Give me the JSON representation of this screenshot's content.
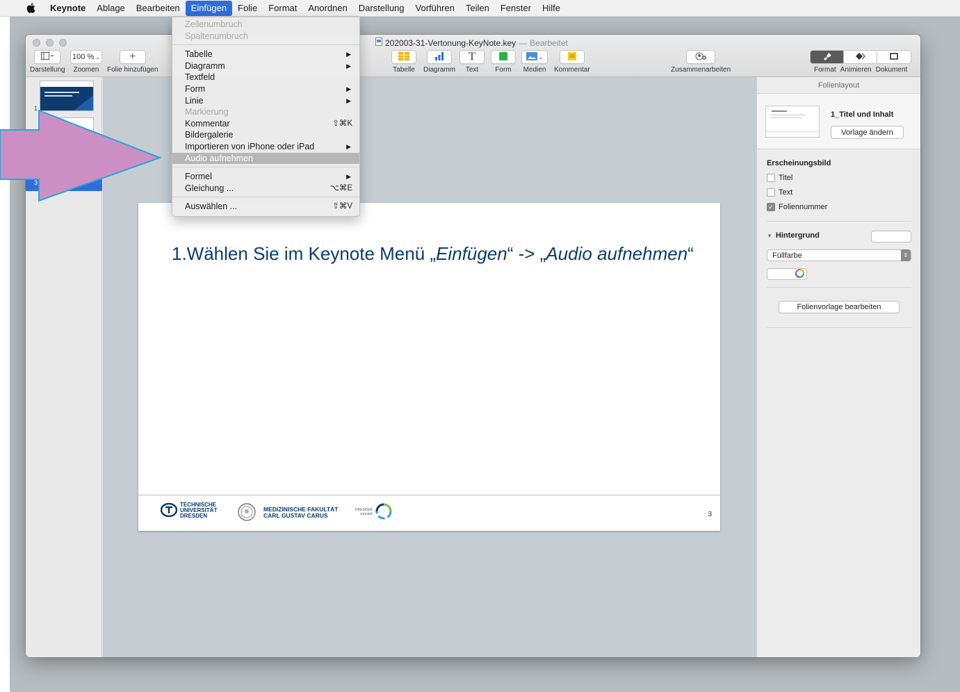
{
  "menubar": {
    "items": [
      "Keynote",
      "Ablage",
      "Bearbeiten",
      "Einfügen",
      "Folie",
      "Format",
      "Anordnen",
      "Darstellung",
      "Vorführen",
      "Teilen",
      "Fenster",
      "Hilfe"
    ],
    "active_index": 3
  },
  "window": {
    "title": "202003-31-Vertonung-KeyNote.key",
    "title_sep": "—",
    "edited": "Bearbeitet"
  },
  "toolbar": {
    "darstellung": "Darstellung",
    "zoom_value": "100 %",
    "zoomen": "Zoomen",
    "add_slide": "Folie hinzufügen",
    "tabelle": "Tabelle",
    "diagramm": "Diagramm",
    "text": "Text",
    "form": "Form",
    "medien": "Medien",
    "kommentar": "Kommentar",
    "zusammenarbeiten": "Zusammenarbeiten",
    "format": "Format",
    "animieren": "Animieren",
    "dokument": "Dokument"
  },
  "navigator": {
    "slide_numbers": [
      "1",
      "3"
    ]
  },
  "menu": {
    "items": [
      {
        "label": "Zeilenumbruch",
        "disabled": true
      },
      {
        "label": "Spaltenumbruch",
        "disabled": true
      },
      {
        "sep": true
      },
      {
        "label": "Tabelle",
        "submenu": true
      },
      {
        "label": "Diagramm",
        "submenu": true
      },
      {
        "label": "Textfeld"
      },
      {
        "label": "Form",
        "submenu": true
      },
      {
        "label": "Linie",
        "submenu": true
      },
      {
        "label": "Markierung",
        "disabled": true
      },
      {
        "label": "Kommentar",
        "shortcut": "⇧⌘K"
      },
      {
        "label": "Bildergalerie"
      },
      {
        "label": "Importieren von iPhone oder iPad",
        "submenu": true
      },
      {
        "label": "Audio aufnehmen",
        "highlighted": true
      },
      {
        "sep": true
      },
      {
        "label": "Formel",
        "submenu": true
      },
      {
        "label": "Gleichung ...",
        "shortcut": "⌥⌘E"
      },
      {
        "sep": true
      },
      {
        "label": "Auswählen ...",
        "shortcut": "⇧⌘V"
      }
    ]
  },
  "slide": {
    "headline_prefix": "1.Wählen Sie im Keynote Menü „",
    "headline_em1": "Einfügen",
    "headline_mid": "“ -> „",
    "headline_em2": "Audio aufnehmen",
    "headline_suffix": "“",
    "page_number": "3",
    "logo_tu": [
      "TECHNISCHE",
      "UNIVERSITÄT",
      "DRESDEN"
    ],
    "logo_med": [
      "MEDIZINISCHE FAKULTÄT",
      "CARL GUSTAV CARUS"
    ],
    "logo_dresden": [
      "DRESDEN",
      "concept"
    ]
  },
  "inspector": {
    "header": "Folienlayout",
    "layout_name": "1_Titel und Inhalt",
    "change_master": "Vorlage ändern",
    "appearance": "Erscheinungsbild",
    "cb_titel": "Titel",
    "cb_text": "Text",
    "cb_foliennummer": "Foliennummer",
    "hintergrund": "Hintergrund",
    "fill_select": "Füllfarbe",
    "edit_master": "Folienvorlage bearbeiten"
  },
  "colors": {
    "accent": "#2f6ed8",
    "arrow_fill": "#cc8fc4",
    "arrow_stroke": "#2aa5d8",
    "slide_text": "#0b3c6e"
  }
}
